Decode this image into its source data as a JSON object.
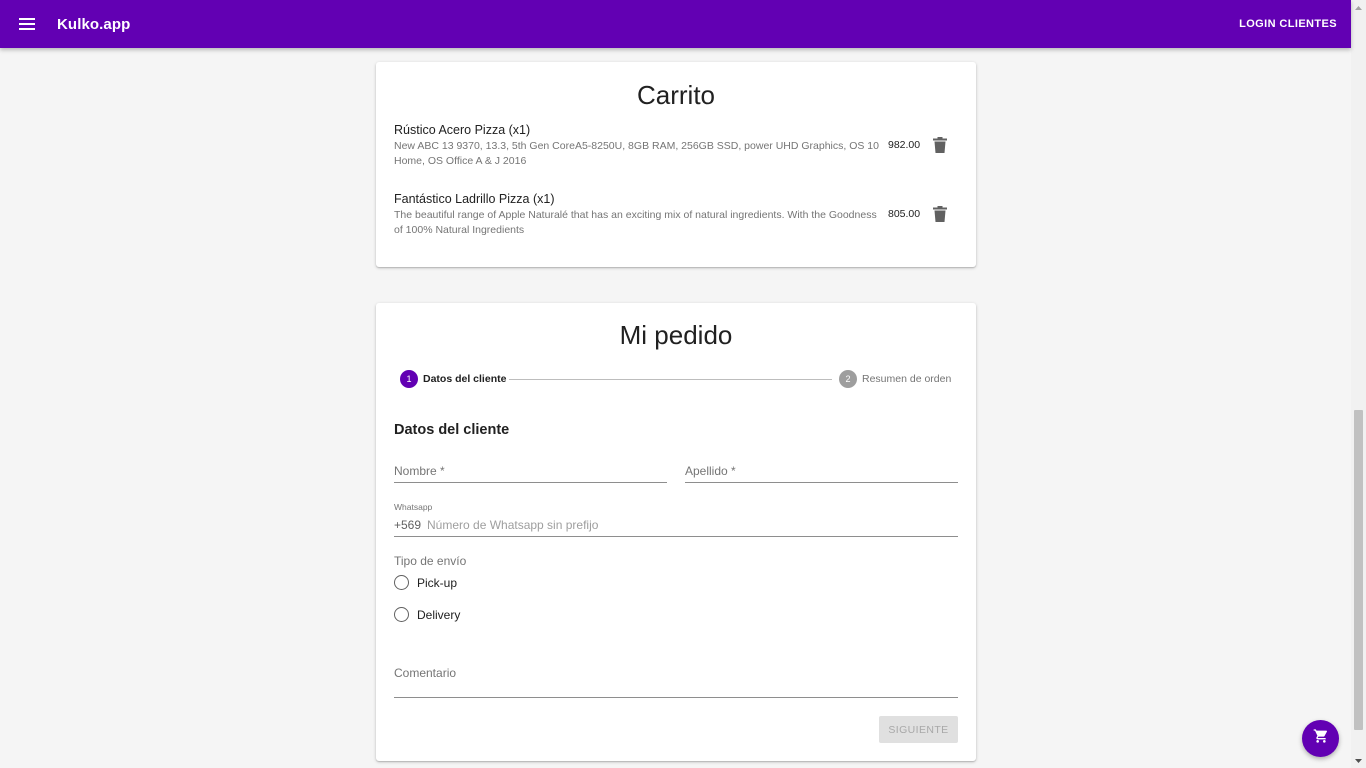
{
  "appbar": {
    "menu_icon": "menu-icon",
    "title": "Kulko.app",
    "login_label": "LOGIN CLIENTES",
    "color": "#6200b3"
  },
  "cart": {
    "title": "Carrito",
    "items": [
      {
        "name": "Rústico Acero Pizza (x1)",
        "description": "New ABC 13 9370, 13.3, 5th Gen CoreA5-8250U, 8GB RAM, 256GB SSD, power UHD Graphics, OS 10 Home, OS Office A & J 2016",
        "price": "982.00",
        "delete_icon": "trash-icon"
      },
      {
        "name": "Fantástico Ladrillo Pizza (x1)",
        "description": "The beautiful range of Apple Naturalé that has an exciting mix of natural ingredients. With the Goodness of 100% Natural Ingredients",
        "price": "805.00",
        "delete_icon": "trash-icon"
      }
    ]
  },
  "order": {
    "title": "Mi pedido",
    "steps": [
      {
        "number": "1",
        "label": "Datos del cliente",
        "active": true,
        "color": "#6200b3"
      },
      {
        "number": "2",
        "label": "Resumen de orden",
        "active": false,
        "color": "#9e9e9e"
      }
    ],
    "section_title": "Datos del cliente",
    "fields": {
      "nombre_label": "Nombre *",
      "apellido_label": "Apellido *",
      "whatsapp_label": "Whatsapp",
      "whatsapp_prefix": "+569",
      "whatsapp_placeholder": "Número de Whatsapp sin prefijo",
      "comment_label": "Comentario"
    },
    "shipping": {
      "legend": "Tipo de envío",
      "options": [
        "Pick-up",
        "Delivery"
      ]
    },
    "next_label": "SIGUIENTE"
  },
  "fab": {
    "icon": "cart-icon"
  }
}
